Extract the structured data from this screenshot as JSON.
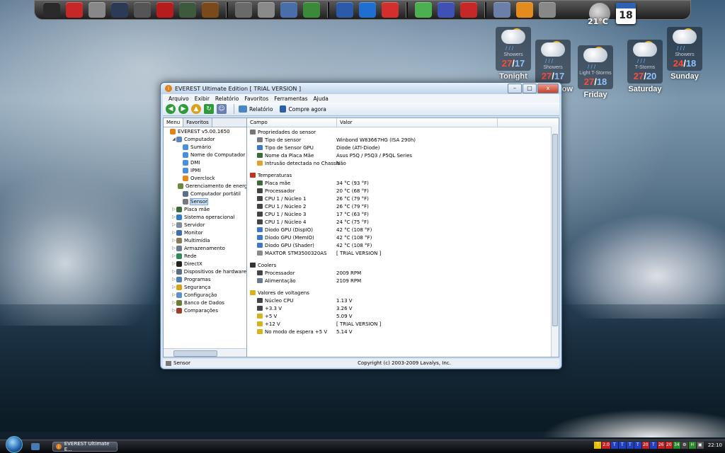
{
  "weather": {
    "current_temp": "21°C",
    "calendar_day": "18",
    "forecast": [
      {
        "day": "Tonight",
        "condition": "Showers",
        "high": "27",
        "low": "17"
      },
      {
        "day": "Tomorrow",
        "condition": "Showers",
        "high": "27",
        "low": "17"
      },
      {
        "day": "Friday",
        "condition": "Light T-Storms",
        "high": "27",
        "low": "18"
      },
      {
        "day": "Saturday",
        "condition": "T-Storms",
        "high": "27",
        "low": "20"
      },
      {
        "day": "Sunday",
        "condition": "Showers",
        "high": "24",
        "low": "18"
      }
    ]
  },
  "window": {
    "title": "EVEREST Ultimate Edition  [ TRIAL VERSION ]",
    "buttons": {
      "minimize": "–",
      "maximize": "□",
      "close": "x"
    }
  },
  "menu": [
    "Arquivo",
    "Exibir",
    "Relatório",
    "Favoritos",
    "Ferramentas",
    "Ajuda"
  ],
  "toolbar": {
    "report_label": "Relatório",
    "buy_label": "Compre agora"
  },
  "tabs": [
    "Menu",
    "Favoritos"
  ],
  "tree": [
    {
      "label": "EVEREST v5.00.1650",
      "level": 0,
      "toggle": "",
      "color": "#e4801a"
    },
    {
      "label": "Computador",
      "level": 1,
      "toggle": "◢",
      "color": "#5a84c4"
    },
    {
      "label": "Sumário",
      "level": 2,
      "toggle": "",
      "color": "#4a8fd8"
    },
    {
      "label": "Nome do Computador",
      "level": 2,
      "toggle": "",
      "color": "#4a8fd8"
    },
    {
      "label": "DMI",
      "level": 2,
      "toggle": "",
      "color": "#4a8fd8"
    },
    {
      "label": "IPMI",
      "level": 2,
      "toggle": "",
      "color": "#4a8fd8"
    },
    {
      "label": "Overclock",
      "level": 2,
      "toggle": "",
      "color": "#e08a20"
    },
    {
      "label": "Gerenciamento de energia",
      "level": 2,
      "toggle": "",
      "color": "#6b8a3c"
    },
    {
      "label": "Computador portátil",
      "level": 2,
      "toggle": "",
      "color": "#5a6f88"
    },
    {
      "label": "Sensor",
      "level": 2,
      "toggle": "",
      "color": "#7a7a7a",
      "selected": true
    },
    {
      "label": "Placa mãe",
      "level": 1,
      "toggle": "▷",
      "color": "#3d6a3d"
    },
    {
      "label": "Sistema operacional",
      "level": 1,
      "toggle": "▷",
      "color": "#2d7fc9"
    },
    {
      "label": "Servidor",
      "level": 1,
      "toggle": "▷",
      "color": "#7f8c99"
    },
    {
      "label": "Monitor",
      "level": 1,
      "toggle": "▷",
      "color": "#3f6ea9"
    },
    {
      "label": "Multimídia",
      "level": 1,
      "toggle": "▷",
      "color": "#8a7a55"
    },
    {
      "label": "Armazenamento",
      "level": 1,
      "toggle": "▷",
      "color": "#6d7c8a"
    },
    {
      "label": "Rede",
      "level": 1,
      "toggle": "▷",
      "color": "#2e8b57"
    },
    {
      "label": "DirectX",
      "level": 1,
      "toggle": "▷",
      "color": "#222222"
    },
    {
      "label": "Dispositivos de hardware",
      "level": 1,
      "toggle": "▷",
      "color": "#5c6e82"
    },
    {
      "label": "Programas",
      "level": 1,
      "toggle": "▷",
      "color": "#4d7fb8"
    },
    {
      "label": "Segurança",
      "level": 1,
      "toggle": "▷",
      "color": "#d6a21b"
    },
    {
      "label": "Configuração",
      "level": 1,
      "toggle": "▷",
      "color": "#5b8fcf"
    },
    {
      "label": "Banco de Dados",
      "level": 1,
      "toggle": "▷",
      "color": "#6b7d3a"
    },
    {
      "label": "Comparações",
      "level": 1,
      "toggle": "▷",
      "color": "#a03b2a"
    }
  ],
  "columns": {
    "field": "Campo",
    "value": "Valor"
  },
  "rows": [
    {
      "type": "section",
      "field": "Propriedades do sensor",
      "color": "#777777"
    },
    {
      "type": "item",
      "field": "Tipo de sensor",
      "value": "Winbond W83667HG  (ISA 290h)",
      "color": "#7a7a7a"
    },
    {
      "type": "item",
      "field": "Tipo de Sensor GPU",
      "value": "Diode  (ATI-Diode)",
      "color": "#3c78c8"
    },
    {
      "type": "item",
      "field": "Nome da Placa Mãe",
      "value": "Asus P5Q / P5Q3 / P5QL Series",
      "color": "#3d6a3d"
    },
    {
      "type": "item",
      "field": "Intrusão detectada no Chassis",
      "value": "Não",
      "color": "#e0a22a"
    },
    {
      "type": "gap"
    },
    {
      "type": "section",
      "field": "Temperaturas",
      "color": "#c8301e"
    },
    {
      "type": "item",
      "field": "Placa mãe",
      "value": "34 °C  (93 °F)",
      "color": "#3d6a3d"
    },
    {
      "type": "item",
      "field": "Processador",
      "value": "20 °C  (68 °F)",
      "color": "#444444"
    },
    {
      "type": "item",
      "field": "CPU 1 / Núcleo 1",
      "value": "26 °C  (79 °F)",
      "color": "#444444"
    },
    {
      "type": "item",
      "field": "CPU 1 / Núcleo 2",
      "value": "26 °C  (79 °F)",
      "color": "#444444"
    },
    {
      "type": "item",
      "field": "CPU 1 / Núcleo 3",
      "value": "17 °C  (63 °F)",
      "color": "#444444"
    },
    {
      "type": "item",
      "field": "CPU 1 / Núcleo 4",
      "value": "24 °C  (75 °F)",
      "color": "#444444"
    },
    {
      "type": "item",
      "field": "Diodo GPU (DispIO)",
      "value": "42 °C  (108 °F)",
      "color": "#3c78c8"
    },
    {
      "type": "item",
      "field": "Diodo GPU (MemIO)",
      "value": "42 °C  (108 °F)",
      "color": "#3c78c8"
    },
    {
      "type": "item",
      "field": "Diodo GPU (Shader)",
      "value": "42 °C  (108 °F)",
      "color": "#3c78c8"
    },
    {
      "type": "item",
      "field": "MAXTOR STM3500320AS",
      "value": "[ TRIAL VERSION ]",
      "color": "#8a8a8a"
    },
    {
      "type": "gap"
    },
    {
      "type": "section",
      "field": "Coolers",
      "color": "#333333"
    },
    {
      "type": "item",
      "field": "Processador",
      "value": "2009 RPM",
      "color": "#444444"
    },
    {
      "type": "item",
      "field": "Alimentação",
      "value": "2109 RPM",
      "color": "#6a7a8a"
    },
    {
      "type": "gap"
    },
    {
      "type": "section",
      "field": "Valores de voltagens",
      "color": "#d9b21c"
    },
    {
      "type": "item",
      "field": "Núcleo CPU",
      "value": "1.13 V",
      "color": "#444444"
    },
    {
      "type": "item",
      "field": "+3.3 V",
      "value": "3.26 V",
      "color": "#444444"
    },
    {
      "type": "item",
      "field": "+5 V",
      "value": "5.09 V",
      "color": "#d9b21c"
    },
    {
      "type": "item",
      "field": "+12 V",
      "value": "[ TRIAL VERSION ]",
      "color": "#d9b21c"
    },
    {
      "type": "item",
      "field": "No modo de espera +5 V",
      "value": "5.14 V",
      "color": "#d9b21c"
    }
  ],
  "status": {
    "left": "Sensor",
    "right": "Copyright (c) 2003-2009 Lavalys, Inc."
  },
  "taskbar": {
    "task_label": "EVEREST Ultimate E...",
    "tray": [
      {
        "text": "T",
        "color": "#e8c000"
      },
      {
        "text": "2.0",
        "color": "#c02020"
      },
      {
        "text": "T",
        "color": "#2040c0"
      },
      {
        "text": "T",
        "color": "#2040c0"
      },
      {
        "text": "T",
        "color": "#2040c0"
      },
      {
        "text": "T",
        "color": "#2040c0"
      },
      {
        "text": "20",
        "color": "#c02020"
      },
      {
        "text": "T",
        "color": "#2040c0"
      },
      {
        "text": "26",
        "color": "#c02020"
      },
      {
        "text": "20",
        "color": "#c02020"
      },
      {
        "text": "34",
        "color": "#2a8a2a"
      },
      {
        "text": "⚙",
        "color": "#444444"
      },
      {
        "text": "H",
        "color": "#2a8a2a"
      },
      {
        "text": "▣",
        "color": "#555555"
      }
    ],
    "clock": "22:10"
  },
  "dock_colors": [
    "#2a2a2a",
    "#c62828",
    "#888888",
    "#2b3a55",
    "#555555",
    "#b71c1c",
    "#3d5a3d",
    "#7a4a1a",
    "#6a6a6a",
    "#8a8a8a",
    "#4a6fa8",
    "#3a8a3a",
    "#2a5aa8",
    "#1e6fd0",
    "#d32f2f",
    "#4caf50",
    "#3f51b5",
    "#c62828",
    "#6b7fa8",
    "#e38b1c",
    "#888888"
  ]
}
